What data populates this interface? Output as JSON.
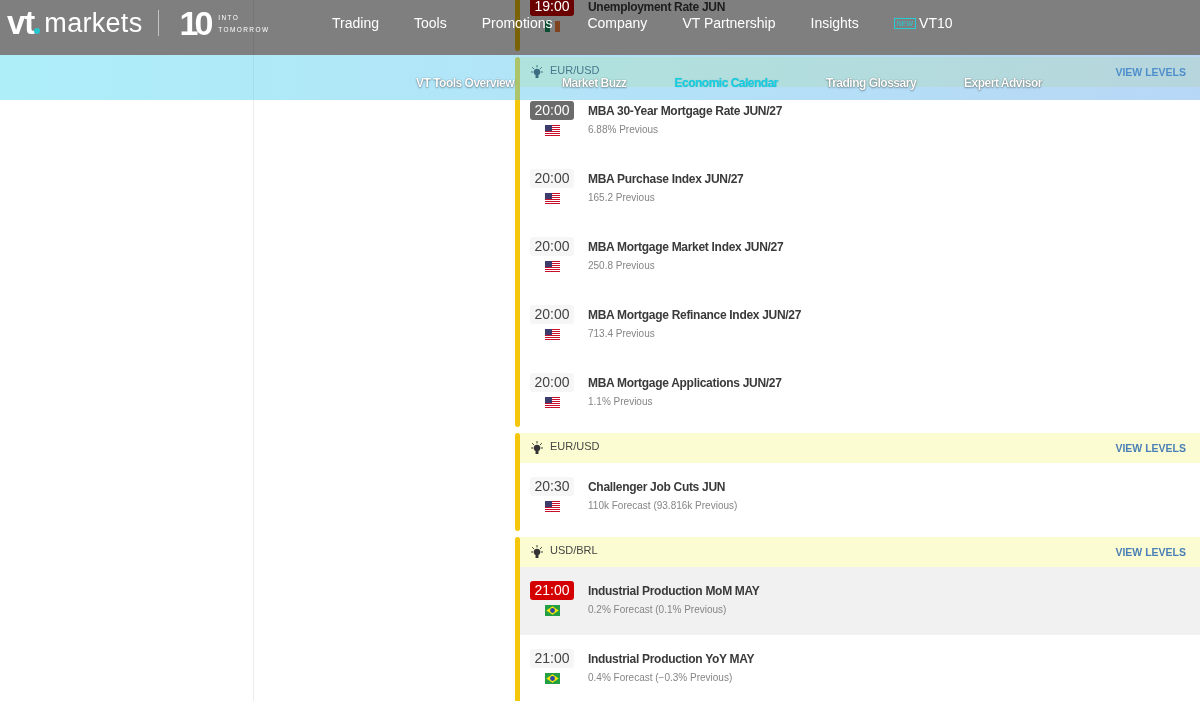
{
  "header": {
    "logo": {
      "brand_short": "vt",
      "brand_rest": "markets",
      "anniversary": "10",
      "tagline": [
        "INTO",
        "TOMORROW"
      ]
    },
    "nav": [
      {
        "label": "Trading"
      },
      {
        "label": "Tools"
      },
      {
        "label": "Promotions"
      },
      {
        "label": "Company"
      },
      {
        "label": "VT Partnership"
      },
      {
        "label": "Insights"
      },
      {
        "label": "VT10",
        "badge": "NEW"
      }
    ]
  },
  "subnav": {
    "tabs": [
      {
        "label": "VT Tools Overview",
        "selected": false
      },
      {
        "label": "Market Buzz",
        "selected": false
      },
      {
        "label": "Economic Calendar",
        "selected": true
      },
      {
        "label": "Trading Glossary",
        "selected": false
      },
      {
        "label": "Expert Advisor",
        "selected": false
      }
    ]
  },
  "calendar": {
    "groups": [
      {
        "events": [
          {
            "time": "19:00",
            "color": "#6a0000",
            "flag": {
              "kind": "ie"
            },
            "title": "Unemployment Rate JUN"
          }
        ]
      },
      {
        "pair": "EUR/USD",
        "action": "VIEW LEVELS",
        "events": [
          {
            "time": "20:00",
            "color": "#6b6b6b",
            "flag": {
              "kind": "us"
            },
            "title": "MBA 30-Year Mortgage Rate JUN/27",
            "detail": "6.88% Previous",
            "highlighted": false
          },
          {
            "time": "20:00",
            "color": "#f6f6f6",
            "flag": {
              "kind": "us"
            },
            "title": "MBA Purchase Index JUN/27",
            "detail": "165.2 Previous",
            "highlighted": false
          },
          {
            "time": "20:00",
            "color": "#f6f6f6",
            "flag": {
              "kind": "us"
            },
            "title": "MBA Mortgage Market Index JUN/27",
            "detail": "250.8 Previous",
            "highlighted": false
          },
          {
            "time": "20:00",
            "color": "#f6f6f6",
            "flag": {
              "kind": "us"
            },
            "title": "MBA Mortgage Refinance Index JUN/27",
            "detail": "713.4 Previous",
            "highlighted": false
          },
          {
            "time": "20:00",
            "color": "#f6f6f6",
            "flag": {
              "kind": "us"
            },
            "title": "MBA Mortgage Applications JUN/27",
            "detail": "1.1% Previous",
            "highlighted": false
          }
        ]
      },
      {
        "pair": "EUR/USD",
        "action": "VIEW LEVELS",
        "events": [
          {
            "time": "20:30",
            "color": "#f6f6f6",
            "flag": {
              "kind": "us"
            },
            "title": "Challenger Job Cuts JUN",
            "detail": "110k Forecast (93.816k Previous)",
            "highlighted": false
          }
        ]
      },
      {
        "pair": "USD/BRL",
        "action": "VIEW LEVELS",
        "events": [
          {
            "time": "21:00",
            "color": "#d40000",
            "flag": {
              "kind": "br"
            },
            "title": "Industrial Production MoM MAY",
            "detail": "0.2% Forecast (0.1% Previous)",
            "highlighted": true
          },
          {
            "time": "21:00",
            "color": "#f6f6f6",
            "flag": {
              "kind": "br"
            },
            "title": "Industrial Production YoY MAY",
            "detail": "0.4% Forecast (−0.3% Previous)",
            "highlighted": false
          }
        ]
      }
    ]
  }
}
